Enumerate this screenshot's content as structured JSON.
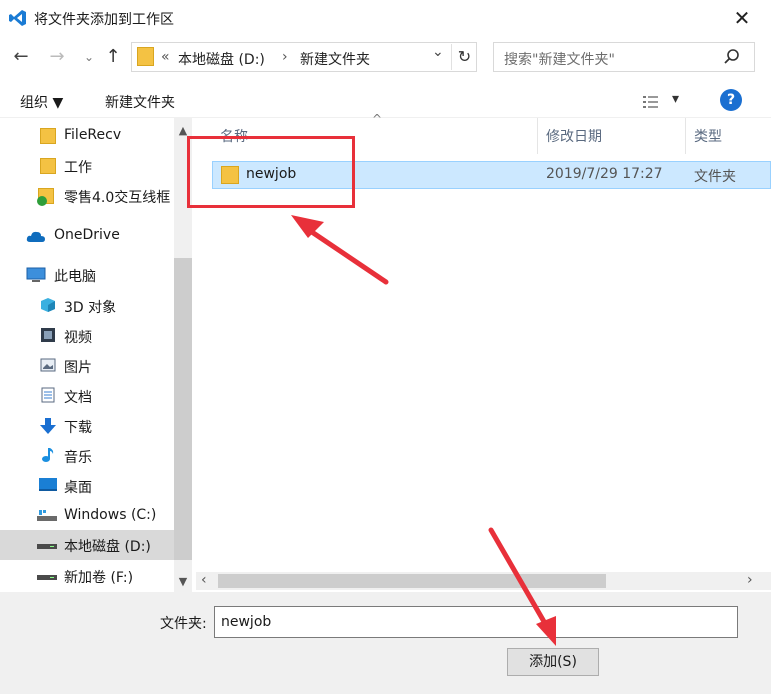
{
  "window": {
    "title": "将文件夹添加到工作区",
    "close": "✕"
  },
  "address": {
    "overflow": "«",
    "crumbs": [
      "本地磁盘 (D:)",
      "新建文件夹"
    ],
    "separator": "›",
    "dropdown": "⌄",
    "refresh": "↻"
  },
  "search": {
    "placeholder": "搜索\"新建文件夹\""
  },
  "toolbar": {
    "organize": "组织 ▼",
    "new_folder": "新建文件夹",
    "view": "▾",
    "help": "?"
  },
  "navpane": {
    "items": [
      {
        "label": "FileRecv",
        "icon": "folder-icon"
      },
      {
        "label": "工作",
        "icon": "folder-icon"
      },
      {
        "label": "零售4.0交互线框",
        "icon": "folder-sync-icon"
      },
      {
        "label": "OneDrive",
        "icon": "cloud-icon"
      },
      {
        "label": "此电脑",
        "icon": "computer-icon"
      },
      {
        "label": "3D 对象",
        "icon": "cube-icon"
      },
      {
        "label": "视频",
        "icon": "video-icon"
      },
      {
        "label": "图片",
        "icon": "picture-icon"
      },
      {
        "label": "文档",
        "icon": "document-icon"
      },
      {
        "label": "下载",
        "icon": "download-icon"
      },
      {
        "label": "音乐",
        "icon": "music-icon"
      },
      {
        "label": "桌面",
        "icon": "desktop-icon"
      },
      {
        "label": "Windows (C:)",
        "icon": "drive-icon"
      },
      {
        "label": "本地磁盘 (D:)",
        "icon": "drive-icon",
        "selected": true
      },
      {
        "label": "新加卷 (F:)",
        "icon": "drive-icon"
      }
    ]
  },
  "list": {
    "columns": {
      "name": "名称",
      "date": "修改日期",
      "type": "类型"
    },
    "rows": [
      {
        "name": "newjob",
        "date": "2019/7/29 17:27",
        "type": "文件夹"
      }
    ]
  },
  "footer": {
    "folder_label": "文件夹:",
    "folder_value": "newjob",
    "add_button": "添加(S)"
  },
  "colors": {
    "selection": "#cce8ff",
    "annotation": "#e8303a",
    "accent": "#1a6fd1"
  }
}
